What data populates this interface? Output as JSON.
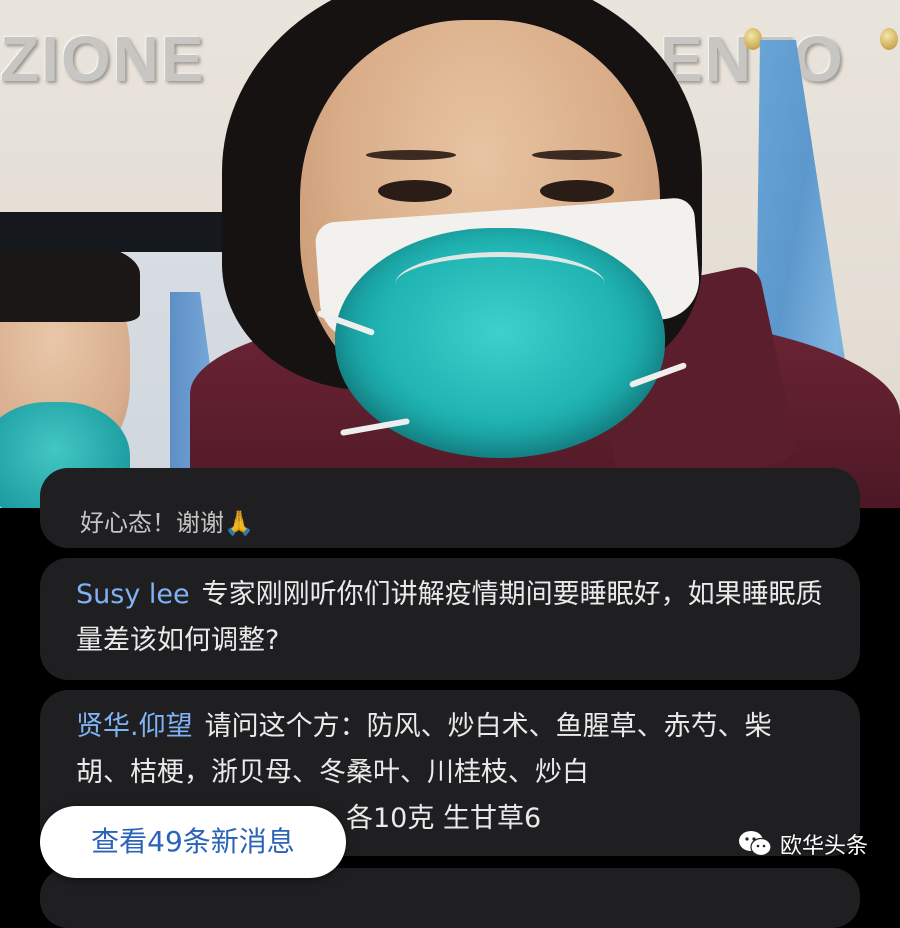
{
  "video": {
    "wall_text_left": "ZIONE",
    "wall_text_right": "ENTO",
    "prev_message_fragment": "好心态！谢谢🙏"
  },
  "comments": [
    {
      "username": "Susy lee",
      "message": "专家刚刚听你们讲解疫情期间要睡眠好，如果睡眠质量差该如何调整?"
    },
    {
      "username": "贤华.仰望",
      "message": "请问这个方：防风、炒白术、鱼腥草、赤芍、柴胡、桔梗，浙贝母、冬桑叶、川桂枝、炒白",
      "message_tail": "各10克 生甘草6"
    }
  ],
  "new_messages_button": "查看49条新消息",
  "watermark": {
    "icon": "wechat-icon",
    "text": "欧华头条"
  },
  "colors": {
    "username": "#7fb3f5",
    "bubble_bg": "#1f1f22",
    "button_text": "#2a63b8"
  }
}
